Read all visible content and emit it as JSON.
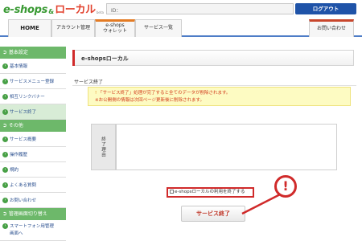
{
  "header": {
    "logo": {
      "part1": "e-shops",
      "amp": "&",
      "part2": "ローカル",
      "tag": "beta"
    },
    "id_label": "ID：",
    "logout_label": "ログアウト"
  },
  "nav": {
    "home": "HOME",
    "account": "アカウント管理",
    "wallet_line1": "e-shops",
    "wallet_line2": "ウォレット",
    "service_list": "サービス一覧",
    "contact": "お問い合わせ"
  },
  "sidebar": {
    "group1": "基本設定",
    "items1": [
      "基本情報",
      "サービスメニュー登録",
      "相互リンクバナー",
      "サービス終了"
    ],
    "group2": "その他",
    "items2": [
      "サービス概要",
      "操作履歴",
      "規約",
      "よくある質問",
      "お問い合わせ"
    ],
    "group3": "管理画面切り替え",
    "items3_line1": "スマートフォン用管理",
    "items3_line2": "画面へ"
  },
  "main": {
    "title": "e-shopsローカル",
    "section_title": "サービス終了",
    "notice_line1": "「サービス終了」処理が完了すると全てのデータが削除されます。",
    "notice_line2": "※お公開側の情報は次回ページ更新後に削除されます。",
    "notice_icon": "!",
    "form_label": "終了理由",
    "checkbox_label": "e-shopsローカルの利用を終了する",
    "end_button": "サービス終了"
  },
  "callout": {
    "symbol": "!"
  },
  "colors": {
    "accent_blue": "#1f53a8",
    "sidebar_green": "#6db86a",
    "alert_red": "#d02a2a"
  }
}
